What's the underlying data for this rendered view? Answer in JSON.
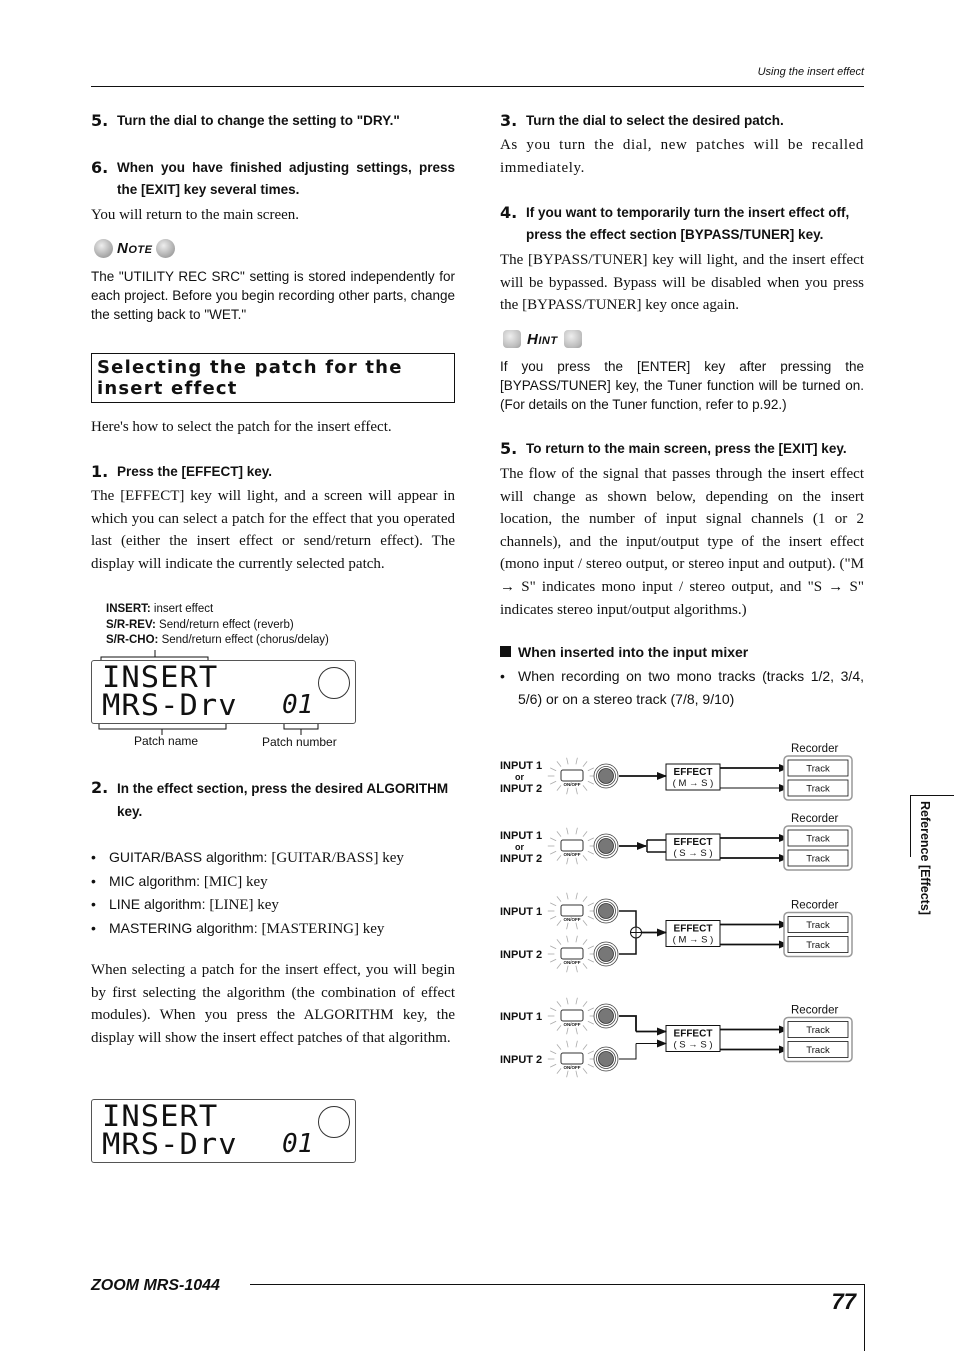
{
  "header": {
    "running_title": "Using the insert effect"
  },
  "left_column": {
    "step5": {
      "number": "5.",
      "text": "Turn the dial to change the setting to \"DRY.\""
    },
    "step6": {
      "number": "6.",
      "text": "When you have finished adjusting settings, press the [EXIT] key several times."
    },
    "step6_body": "You will return to the main screen.",
    "note": {
      "title": "Note",
      "text": "The \"UTILITY REC SRC\" setting is stored independently for each project. Before you begin recording other parts, change the setting back to \"WET.\""
    },
    "section_title": "Selecting the patch for the insert effect",
    "intro": "Here's how to select the patch for the insert effect.",
    "step1": {
      "number": "1.",
      "text": "Press the [EFFECT] key."
    },
    "step1_body": "The [EFFECT] key will light, and a screen will appear in which you can select a patch for the effect that you operated last (either the insert effect or send/return effect). The display will indicate the currently selected patch.",
    "display_figure": {
      "legend": [
        {
          "term": "INSERT:",
          "desc": " insert effect"
        },
        {
          "term": "S/R-REV:",
          "desc": " Send/return effect (reverb)"
        },
        {
          "term": "S/R-CHO:",
          "desc": " Send/return effect (chorus/delay)"
        }
      ],
      "lcd_line1": "INSERT",
      "lcd_line2": "MRS-Drv",
      "lcd_number": "01",
      "label_patch_name": "Patch name",
      "label_patch_number": "Patch number"
    },
    "step2": {
      "number": "2.",
      "text": "In the effect section, press the desired ALGORITHM key."
    },
    "algorithms": [
      {
        "name": "GUITAR/BASS algorithm: ",
        "key": "[GUITAR/BASS] key"
      },
      {
        "name": "MIC algorithm: ",
        "key": "[MIC] key"
      },
      {
        "name": "LINE algorithm: ",
        "key": "[LINE] key"
      },
      {
        "name": "MASTERING algorithm: ",
        "key": "[MASTERING] key"
      }
    ],
    "algorithm_body": "When selecting a patch for the insert effect, you will begin by first selecting the algorithm (the combination of effect modules). When you press the ALGORITHM key, the display will show the insert effect patches of that algorithm.",
    "display2": {
      "lcd_line1": "INSERT",
      "lcd_line2": "MRS-Drv",
      "lcd_number": "01"
    }
  },
  "right_column": {
    "step3": {
      "number": "3.",
      "text": "Turn the dial to select the desired patch."
    },
    "step3_body": "As you turn the dial, new patches will be recalled immediately.",
    "step4": {
      "number": "4.",
      "text": "If you want to temporarily turn the insert effect off, press the effect section [BYPASS/TUNER] key."
    },
    "step4_body": "The [BYPASS/TUNER] key will light, and the insert effect will be bypassed. Bypass will be disabled when you press the [BYPASS/TUNER] key once again.",
    "hint": {
      "title": "Hint",
      "text": "If you press the [ENTER] key after pressing the [BYPASS/TUNER] key, the Tuner function will be turned on. (For details on the Tuner function, refer to p.92.)"
    },
    "step5": {
      "number": "5.",
      "text": "To return to the main screen, press the [EXIT] key."
    },
    "step5_body": "The flow of the signal that passes through the insert effect will change as shown below, depending on the insert location, the number of input signal channels (1 or 2 channels), and the input/output type of the insert effect (mono input / stereo output, or stereo input and output). (\"M → S\" indicates mono input / stereo output, and \"S → S\" indicates stereo input/output algorithms.)",
    "subheading": "When inserted into the input mixer",
    "subbullet": "When recording on two mono tracks (tracks 1/2, 3/4, 5/6) or on a stereo track (7/8, 9/10)",
    "diagrams": [
      {
        "inputs": [
          "INPUT 1",
          "or",
          "INPUT 2"
        ],
        "effect": "EFFECT",
        "mode": "( M → S )",
        "recorder": "Recorder",
        "tracks": [
          "Track",
          "Track"
        ],
        "switch_label": "ON/OFF"
      },
      {
        "inputs": [
          "INPUT 1",
          "or",
          "INPUT 2"
        ],
        "effect": "EFFECT",
        "mode": "( S → S )",
        "recorder": "Recorder",
        "tracks": [
          "Track",
          "Track"
        ],
        "switch_label": "ON/OFF"
      },
      {
        "inputs": [
          "INPUT 1",
          "INPUT 2"
        ],
        "effect": "EFFECT",
        "mode": "( M → S )",
        "recorder": "Recorder",
        "tracks": [
          "Track",
          "Track"
        ],
        "switch_label": "ON/OFF"
      },
      {
        "inputs": [
          "INPUT 1",
          "INPUT 2"
        ],
        "effect": "EFFECT",
        "mode": "( S → S )",
        "recorder": "Recorder",
        "tracks": [
          "Track",
          "Track"
        ],
        "switch_label": "ON/OFF"
      }
    ]
  },
  "side_tab": "Reference [Effects]",
  "footer": {
    "model": "ZOOM MRS-1044",
    "page_number": "77"
  }
}
